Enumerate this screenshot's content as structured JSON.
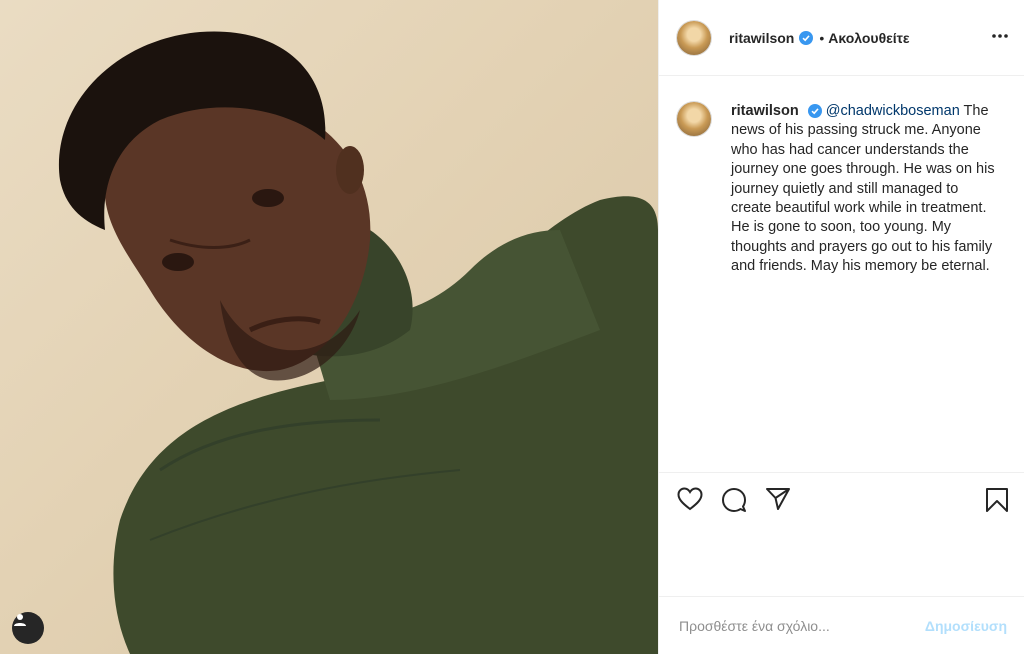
{
  "post": {
    "username": "ritawilson",
    "follow_status": "Ακολουθείτε",
    "separator": "•",
    "caption_mention": "@chadwickboseman",
    "caption_text": " The news of his passing struck me. Anyone who has had cancer understands the journey one goes through. He was on his journey quietly and still managed to create beautiful work while in treatment. He is gone to soon, too young. My thoughts and prayers go out to his family and friends. May his memory be eternal."
  },
  "comment": {
    "placeholder": "Προσθέστε ένα σχόλιο...",
    "post_label": "Δημοσίευση"
  },
  "icons": {
    "verified": "verified-badge-icon",
    "more": "more-options-icon",
    "like": "heart-icon",
    "comment": "comment-bubble-icon",
    "share": "paper-plane-icon",
    "save": "bookmark-icon",
    "tagged": "user-tag-icon"
  },
  "colors": {
    "verified_blue": "#3897f0",
    "mention_blue": "#00376b",
    "post_button_disabled": "#b2dffc",
    "sweater_green": "#3e4a2c"
  }
}
